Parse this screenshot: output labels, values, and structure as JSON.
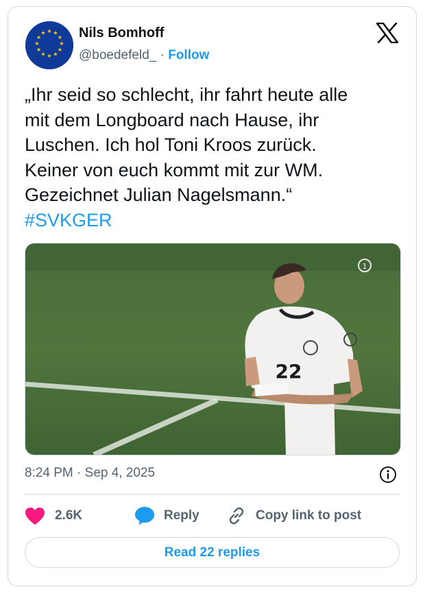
{
  "author": {
    "name": "Nils Bomhoff",
    "handle": "@boedefeld_",
    "separator": "·",
    "follow_label": "Follow"
  },
  "tweet": {
    "text": "„Ihr seid so schlecht, ihr fahrt heute alle\nmit dem Longboard nach Hause, ihr\nLuschen. Ich hol Toni Kroos zurück.\nKeiner von euch kommt mit zur WM.\nGezeichnet Julian Nagelsmann.“",
    "hashtag": "#SVKGER"
  },
  "media": {
    "jersey_number": "22",
    "broadcast_logo": "1"
  },
  "meta": {
    "timestamp": "8:24 PM · Sep 4, 2025"
  },
  "actions": {
    "likes": "2.6K",
    "reply_label": "Reply",
    "copy_label": "Copy link to post"
  },
  "footer": {
    "read_replies": "Read 22 replies"
  },
  "colors": {
    "accent": "#1d9bf0",
    "like": "#f91880",
    "muted": "#536471",
    "border": "#cfd9de"
  },
  "icons": [
    "eu-flag-avatar",
    "x-logo-icon",
    "info-icon",
    "heart-icon",
    "reply-bubble-icon",
    "link-icon"
  ]
}
